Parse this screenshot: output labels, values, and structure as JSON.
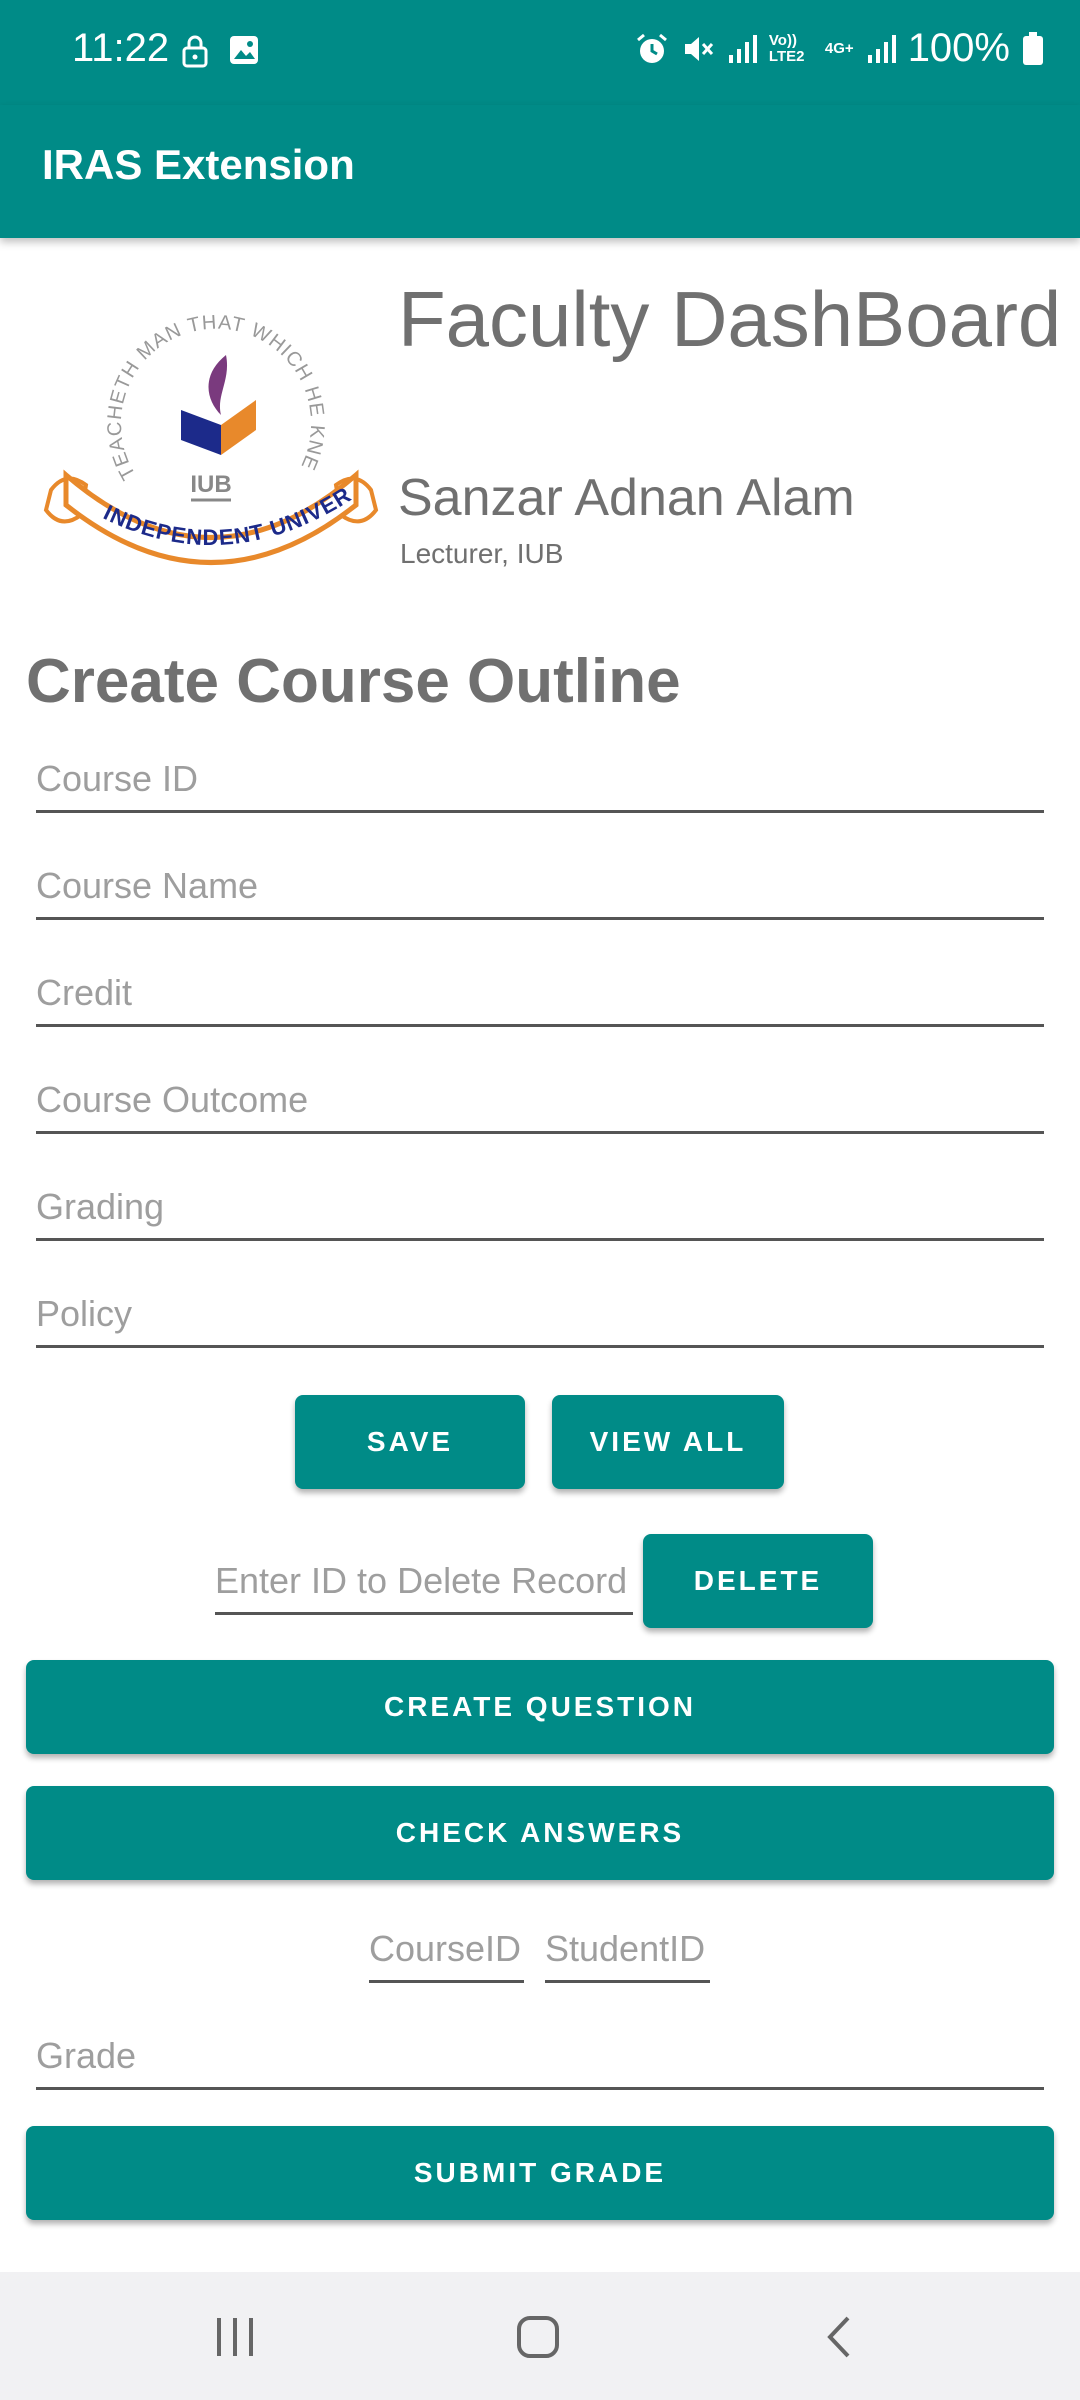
{
  "status_bar": {
    "time": "11:22",
    "battery": "100%",
    "icons_left": [
      "lock-icon",
      "image-icon"
    ],
    "icons_right": [
      "alarm-icon",
      "mute-icon",
      "signal-icon",
      "volte-icon",
      "4g-icon",
      "signal-icon",
      "battery-icon"
    ],
    "network_label": "Vo)) LTE2",
    "data_label": "4G+"
  },
  "app_bar": {
    "title": "IRAS Extension"
  },
  "header": {
    "logo_text": "IUB",
    "logo_motto": "TEACHETH MAN THAT WHICH HE KNEW NOT",
    "logo_banner": "INDEPENDENT UNIVERSITY",
    "title": "Faculty DashBoard",
    "name": "Sanzar Adnan Alam",
    "role": "Lecturer, IUB"
  },
  "form": {
    "section_title": "Create Course Outline",
    "fields": {
      "course_id": "Course ID",
      "course_name": "Course Name",
      "credit": "Credit",
      "course_outcome": "Course Outcome",
      "grading": "Grading",
      "policy": "Policy"
    },
    "save_label": "SAVE",
    "view_all_label": "VIEW ALL",
    "delete_placeholder": "Enter ID to Delete Record",
    "delete_label": "DELETE",
    "create_question_label": "CREATE QUESTION",
    "check_answers_label": "CHECK ANSWERS",
    "course_id_placeholder": "CourseID",
    "student_id_placeholder": "StudentID",
    "grade_placeholder": "Grade",
    "submit_grade_label": "SUBMIT GRADE"
  },
  "colors": {
    "primary": "#008b87",
    "text_gray": "#707070",
    "hint_gray": "#9e9e9e",
    "logo_orange": "#e8892b",
    "logo_navy": "#1c2a8a",
    "logo_purple": "#7a3a7e"
  },
  "nav_bar": {
    "icons": [
      "recent-apps-icon",
      "home-icon",
      "back-icon"
    ]
  }
}
